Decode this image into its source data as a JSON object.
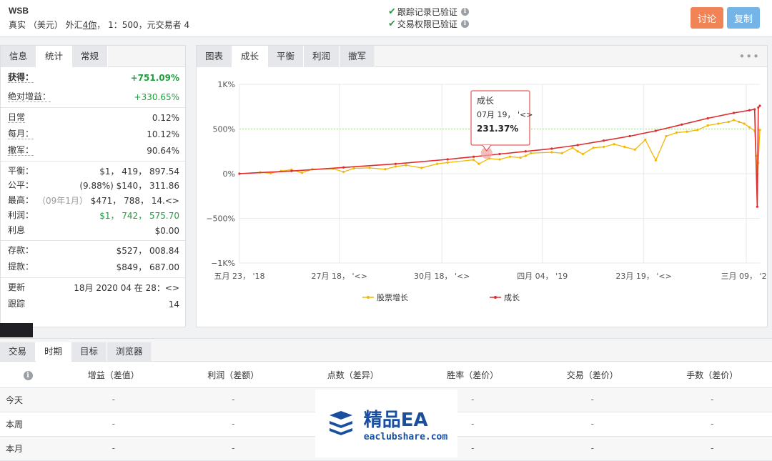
{
  "header": {
    "account_name": "WSB",
    "account_desc_pre": "真实 （美元） 外汇",
    "account_desc_link": "4你",
    "account_desc_post": "， 1：500，元交易者 4",
    "verify_track": "跟踪记录已验证",
    "verify_trade": "交易权限已验证",
    "btn_discuss": "讨论",
    "btn_copy": "复制"
  },
  "left_panel": {
    "tabs": [
      "信息",
      "统计",
      "常规"
    ],
    "active_tab": 1,
    "gain_label": "获得：",
    "gain_value": "+751.09%",
    "abs_gain_label": "绝对增益：",
    "abs_gain_value": "+330.65%",
    "daily_label": "日常",
    "daily_value": "0.12%",
    "monthly_label": "每月：",
    "monthly_value": "10.12%",
    "drawdown_label": "撤军：",
    "drawdown_value": "90.64%",
    "balance_label": "平衡：",
    "balance_value": "$1， 419， 897.54",
    "equity_label": "公平：",
    "equity_pct": "(9.88%)",
    "equity_value": "$140， 311.86",
    "highest_label": "最高：",
    "highest_date": "（09年1月）",
    "highest_value": "$471， 788， 14.<>",
    "profit_label": "利润：",
    "profit_value": "$1， 742， 575.70",
    "interest_label": "利息",
    "interest_value": "$0.00",
    "deposit_label": "存款：",
    "deposit_value": "$527， 008.84",
    "withdraw_label": "提款：",
    "withdraw_value": "$849， 687.00",
    "updated_label": "更新",
    "updated_value": "18月 2020 04 在 28：<>",
    "tracking_label": "跟踪",
    "tracking_value": "14"
  },
  "chart_panel": {
    "tabs": [
      "图表",
      "成长",
      "平衡",
      "利润",
      "撤军"
    ],
    "active_tab": 1,
    "more_icon": "•••"
  },
  "chart_data": {
    "type": "line",
    "y_ticks": [
      "1K%",
      "500%",
      "0%",
      "−500%",
      "−1K%"
    ],
    "y_tick_values": [
      1000,
      500,
      0,
      -500,
      -1000
    ],
    "ylim": [
      -1000,
      1000
    ],
    "x_ticks": [
      "五月 23， '18",
      "27月 18， '<>",
      "30月 18， '<>",
      "四月 04， '19",
      "23月 19， '<>",
      "三月 09， '20"
    ],
    "x_domain": [
      0,
      100
    ],
    "x_tick_positions": [
      0,
      19.2,
      38.9,
      58.2,
      77.7,
      97.4
    ],
    "series": [
      {
        "name": "股票增长",
        "color": "#f2b705",
        "x": [
          0,
          4,
          6,
          8,
          10,
          12,
          14,
          18,
          20,
          22,
          25,
          28,
          30,
          32,
          35,
          38,
          40,
          45,
          46,
          48,
          50,
          52,
          54,
          55,
          56,
          60,
          62,
          64,
          65,
          66,
          68,
          70,
          72,
          74,
          76,
          78,
          80,
          82,
          84,
          86,
          88,
          90,
          92,
          94,
          95,
          96,
          97,
          98,
          99,
          99.3,
          99.5,
          99.7,
          100
        ],
        "y": [
          0,
          15,
          5,
          30,
          45,
          10,
          50,
          55,
          20,
          60,
          65,
          50,
          80,
          95,
          65,
          110,
          125,
          155,
          110,
          170,
          160,
          190,
          180,
          200,
          230,
          240,
          230,
          290,
          250,
          220,
          290,
          300,
          330,
          300,
          270,
          380,
          150,
          420,
          460,
          470,
          490,
          540,
          560,
          580,
          600,
          580,
          560,
          520,
          480,
          200,
          -10,
          120,
          490
        ]
      },
      {
        "name": "成长",
        "color": "#e02c2c",
        "x": [
          0,
          10,
          20,
          30,
          40,
          45,
          50,
          55,
          60,
          65,
          70,
          75,
          80,
          85,
          90,
          95,
          98,
          99,
          99.5,
          99.7,
          100
        ],
        "y": [
          0,
          30,
          70,
          110,
          160,
          190,
          220,
          250,
          280,
          320,
          370,
          420,
          480,
          550,
          620,
          680,
          710,
          720,
          -370,
          740,
          760
        ]
      }
    ],
    "legend": [
      "股票增长",
      "成长"
    ],
    "legend_position": "bottom",
    "tooltip": {
      "title": "成长",
      "date": "07月 19， '<>",
      "value": "231.37%",
      "point_x": 47.5,
      "point_y": 231.37
    }
  },
  "bottom_panel": {
    "tabs": [
      "交易",
      "时期",
      "目标",
      "浏览器"
    ],
    "active_tab": 1,
    "columns": [
      "增益（差值）",
      "利润（差额）",
      "点数（差异）",
      "胜率（差价）",
      "交易（差价）",
      "手数（差价）"
    ],
    "rows": [
      {
        "label": "今天",
        "cells": [
          "-",
          "-",
          "-",
          "-",
          "-",
          "-"
        ]
      },
      {
        "label": "本周",
        "cells": [
          "-",
          "-",
          "-",
          "-",
          "-",
          "-"
        ]
      },
      {
        "label": "本月",
        "cells": [
          "-",
          "-",
          "-",
          "-",
          "-",
          "-"
        ]
      }
    ]
  },
  "watermark": {
    "title": "精品EA",
    "subtitle": "eaclubshare.com"
  }
}
